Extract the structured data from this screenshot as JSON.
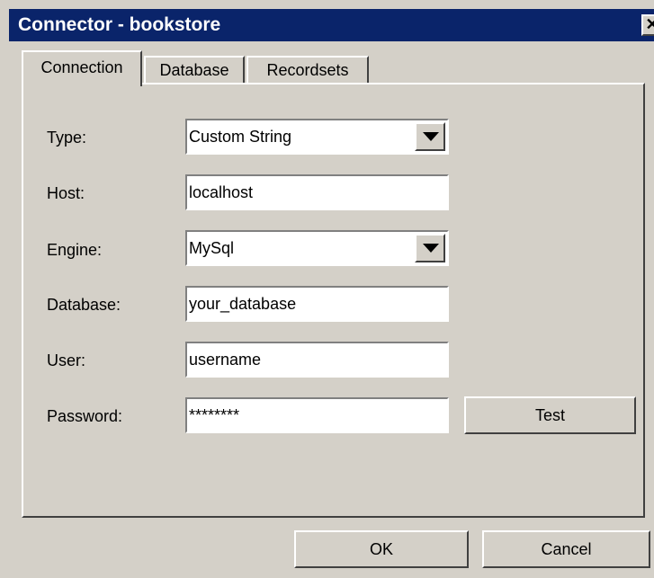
{
  "window": {
    "title": "Connector - bookstore",
    "close_symbol": "✕"
  },
  "tabs": [
    {
      "label": "Connection",
      "active": true
    },
    {
      "label": "Database",
      "active": false
    },
    {
      "label": "Recordsets",
      "active": false
    }
  ],
  "form": {
    "type": {
      "label": "Type:",
      "value": "Custom String"
    },
    "host": {
      "label": "Host:",
      "value": "localhost"
    },
    "engine": {
      "label": "Engine:",
      "value": "MySql"
    },
    "database": {
      "label": "Database:",
      "value": "your_database"
    },
    "user": {
      "label": "User:",
      "value": "username"
    },
    "password": {
      "label": "Password:",
      "value": "********"
    }
  },
  "buttons": {
    "test": "Test",
    "ok": "OK",
    "cancel": "Cancel"
  },
  "colors": {
    "face": "#d4d0c8",
    "titlebar": "#0a246a",
    "field_bg": "#ffffff"
  }
}
